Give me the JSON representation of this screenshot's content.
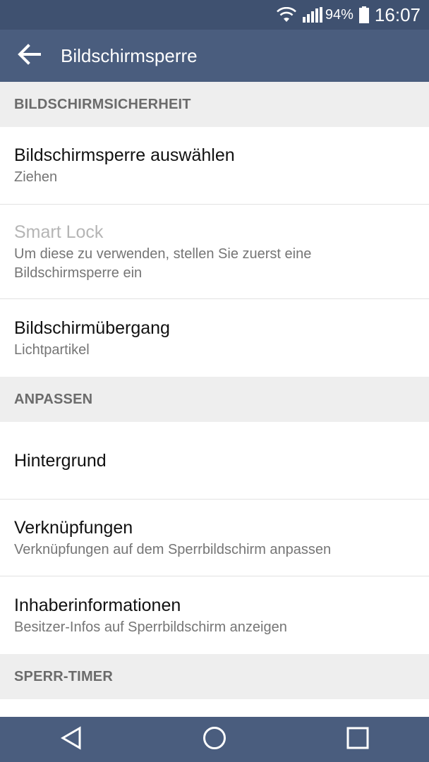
{
  "status_bar": {
    "battery_percent": "94%",
    "time": "16:07",
    "icons": [
      "wifi-icon",
      "signal-icon",
      "battery-icon"
    ]
  },
  "app_bar": {
    "title": "Bildschirmsperre",
    "back_icon": "back-arrow-icon"
  },
  "sections": [
    {
      "header": "BILDSCHIRMSICHERHEIT",
      "items": [
        {
          "title": "Bildschirmsperre auswählen",
          "subtitle": "Ziehen"
        },
        {
          "title": "Smart Lock",
          "subtitle": "Um diese zu verwenden, stellen Sie zuerst eine Bildschirmsperre ein",
          "disabled": true
        },
        {
          "title": "Bildschirmübergang",
          "subtitle": "Lichtpartikel"
        }
      ]
    },
    {
      "header": "ANPASSEN",
      "items": [
        {
          "title": "Hintergrund"
        },
        {
          "title": "Verknüpfungen",
          "subtitle": "Verknüpfungen auf dem Sperrbildschirm anpassen"
        },
        {
          "title": "Inhaberinformationen",
          "subtitle": "Besitzer-Infos auf Sperrbildschirm anzeigen"
        }
      ]
    },
    {
      "header": "SPERR-TIMER",
      "items": []
    }
  ],
  "nav_bar": {
    "icons": [
      "nav-back-icon",
      "nav-home-icon",
      "nav-recents-icon"
    ]
  },
  "colors": {
    "status_bar": "#3f5170",
    "app_bar": "#4a5d7e",
    "section_bg": "#eeeeee",
    "section_text": "#6b6b6b",
    "disabled_text": "#b5b5b5"
  }
}
